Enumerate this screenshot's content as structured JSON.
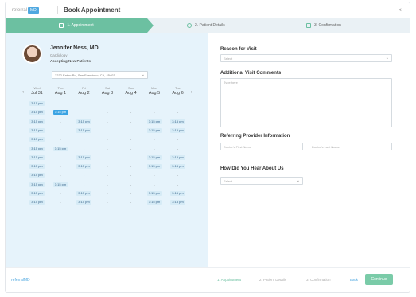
{
  "header": {
    "logo_text": "referral",
    "logo_badge": "MD",
    "title": "Book Appointment",
    "close_glyph": "×"
  },
  "steps": [
    {
      "label": "1. Appointment",
      "icon": "calendar-icon",
      "active": true
    },
    {
      "label": "2. Patient Details",
      "icon": "user-icon",
      "active": false
    },
    {
      "label": "3. Confirmation",
      "icon": "check-icon",
      "active": false
    }
  ],
  "doctor": {
    "name": "Jennifer Ness, MD",
    "specialty": "Cardiology",
    "accepting": "Accepting New Patients",
    "address": "3232 Eaton Rd, San Francisco, CA, 45403"
  },
  "calendar": {
    "days": [
      {
        "dow": "Wed",
        "date": "Jul 31"
      },
      {
        "dow": "Thu",
        "date": "Aug 1"
      },
      {
        "dow": "Fri",
        "date": "Aug 2"
      },
      {
        "dow": "Sat",
        "date": "Aug 3"
      },
      {
        "dow": "Sun",
        "date": "Aug 4"
      },
      {
        "dow": "Mon",
        "date": "Aug 5"
      },
      {
        "dow": "Tue",
        "date": "Aug 6"
      }
    ],
    "rows": [
      [
        "3:15 pm",
        "-",
        "-",
        "-",
        "-",
        "-",
        "-"
      ],
      [
        "3:15 pm",
        "3:15 pm",
        "-",
        "-",
        "-",
        "-",
        "-"
      ],
      [
        "3:15 pm",
        "-",
        "3:15 pm",
        "-",
        "-",
        "3:15 pm",
        "3:15 pm"
      ],
      [
        "3:15 pm",
        "-",
        "3:15 pm",
        "-",
        "-",
        "3:15 pm",
        "3:15 pm"
      ],
      [
        "3:15 pm",
        "-",
        "-",
        "-",
        "-",
        "-",
        "-"
      ],
      [
        "3:15 pm",
        "3:15 pm",
        "-",
        "-",
        "-",
        "-",
        "-"
      ],
      [
        "3:15 pm",
        "-",
        "3:15 pm",
        "-",
        "-",
        "3:15 pm",
        "3:15 pm"
      ],
      [
        "3:15 pm",
        "-",
        "3:15 pm",
        "-",
        "-",
        "3:15 pm",
        "3:15 pm"
      ],
      [
        "3:15 pm",
        "-",
        "-",
        "-",
        "-",
        "-",
        "-"
      ],
      [
        "3:15 pm",
        "3:15 pm",
        "-",
        "-",
        "-",
        "-",
        "-"
      ],
      [
        "3:15 pm",
        "-",
        "3:15 pm",
        "-",
        "-",
        "3:15 pm",
        "3:15 pm"
      ],
      [
        "3:15 pm",
        "-",
        "3:15 pm",
        "-",
        "-",
        "3:15 pm",
        "3:15 pm"
      ]
    ],
    "selected": {
      "row": 1,
      "col": 1
    }
  },
  "form": {
    "reason_label": "Reason for Visit",
    "reason_placeholder": "Select",
    "comments_label": "Additional Visit Comments",
    "comments_placeholder": "Type here",
    "referring_label": "Referring Provider Information",
    "first_name_placeholder": "Doctor's First Name",
    "last_name_placeholder": "Doctor's Last Name",
    "hear_label": "How Did You Hear About Us",
    "hear_placeholder": "Select"
  },
  "footer": {
    "brand": "referralMD",
    "steps": [
      "1. Appointment",
      "2. Patient Details",
      "3. Confirmation"
    ],
    "back_label": "Back",
    "continue_label": "Continue"
  },
  "colors": {
    "accent_green": "#6cc0a1",
    "accent_blue": "#3aa3e3",
    "panel_blue": "#e6f3fb"
  }
}
